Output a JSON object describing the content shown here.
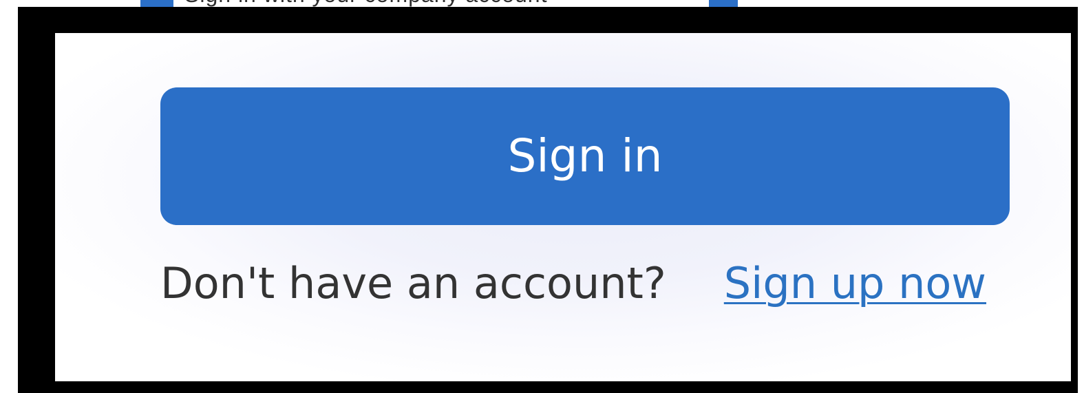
{
  "colors": {
    "accent": "#2b6fc7",
    "link": "#2b72c2",
    "text": "#333333",
    "frame": "#000000",
    "panel_background": "#f1f2fb"
  },
  "top_strip": {
    "cropped_text": "Sign in with your company account"
  },
  "form": {
    "signin_button_label": "Sign in",
    "signup_prompt": "Don't have an account?",
    "signup_link_label": "Sign up now"
  }
}
